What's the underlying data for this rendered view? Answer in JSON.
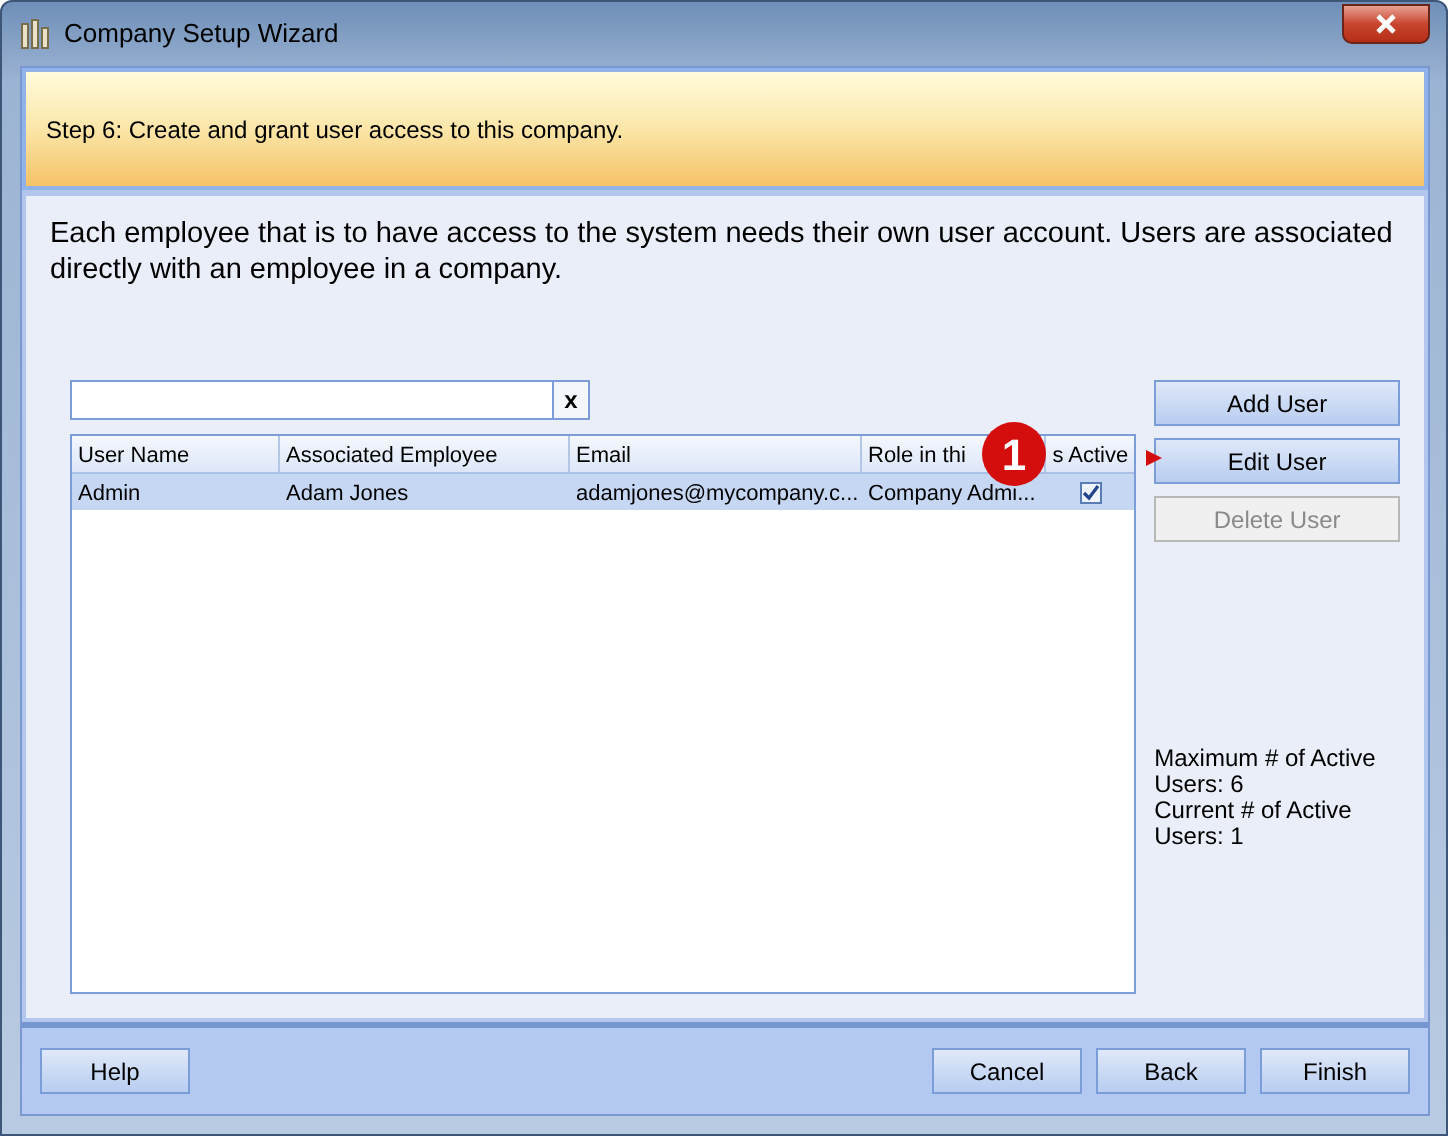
{
  "window": {
    "title": "Company Setup Wizard"
  },
  "header": {
    "step": "Step 6: Create and grant user access to this company."
  },
  "description": "Each employee that is to have access to the system needs their own user account. Users are associated directly with an employee in a company.",
  "search": {
    "clear_label": "x"
  },
  "table": {
    "columns": [
      "User Name",
      "Associated Employee",
      "Email",
      "Role in thi",
      "s Active"
    ],
    "rows": [
      {
        "cells": [
          "Admin",
          "Adam Jones",
          "adamjones@mycompany.c...",
          "Company Admi..."
        ],
        "active": true,
        "selected": true
      }
    ]
  },
  "callout": {
    "label": "1"
  },
  "side_buttons": [
    {
      "label": "Add User",
      "disabled": false
    },
    {
      "label": "Edit User",
      "disabled": false
    },
    {
      "label": "Delete User",
      "disabled": true
    }
  ],
  "limits": [
    "Maximum # of Active Users: 6",
    "Current # of Active Users: 1"
  ],
  "footer": {
    "left": [
      "Help"
    ],
    "right": [
      "Cancel",
      "Back",
      "Finish"
    ]
  }
}
